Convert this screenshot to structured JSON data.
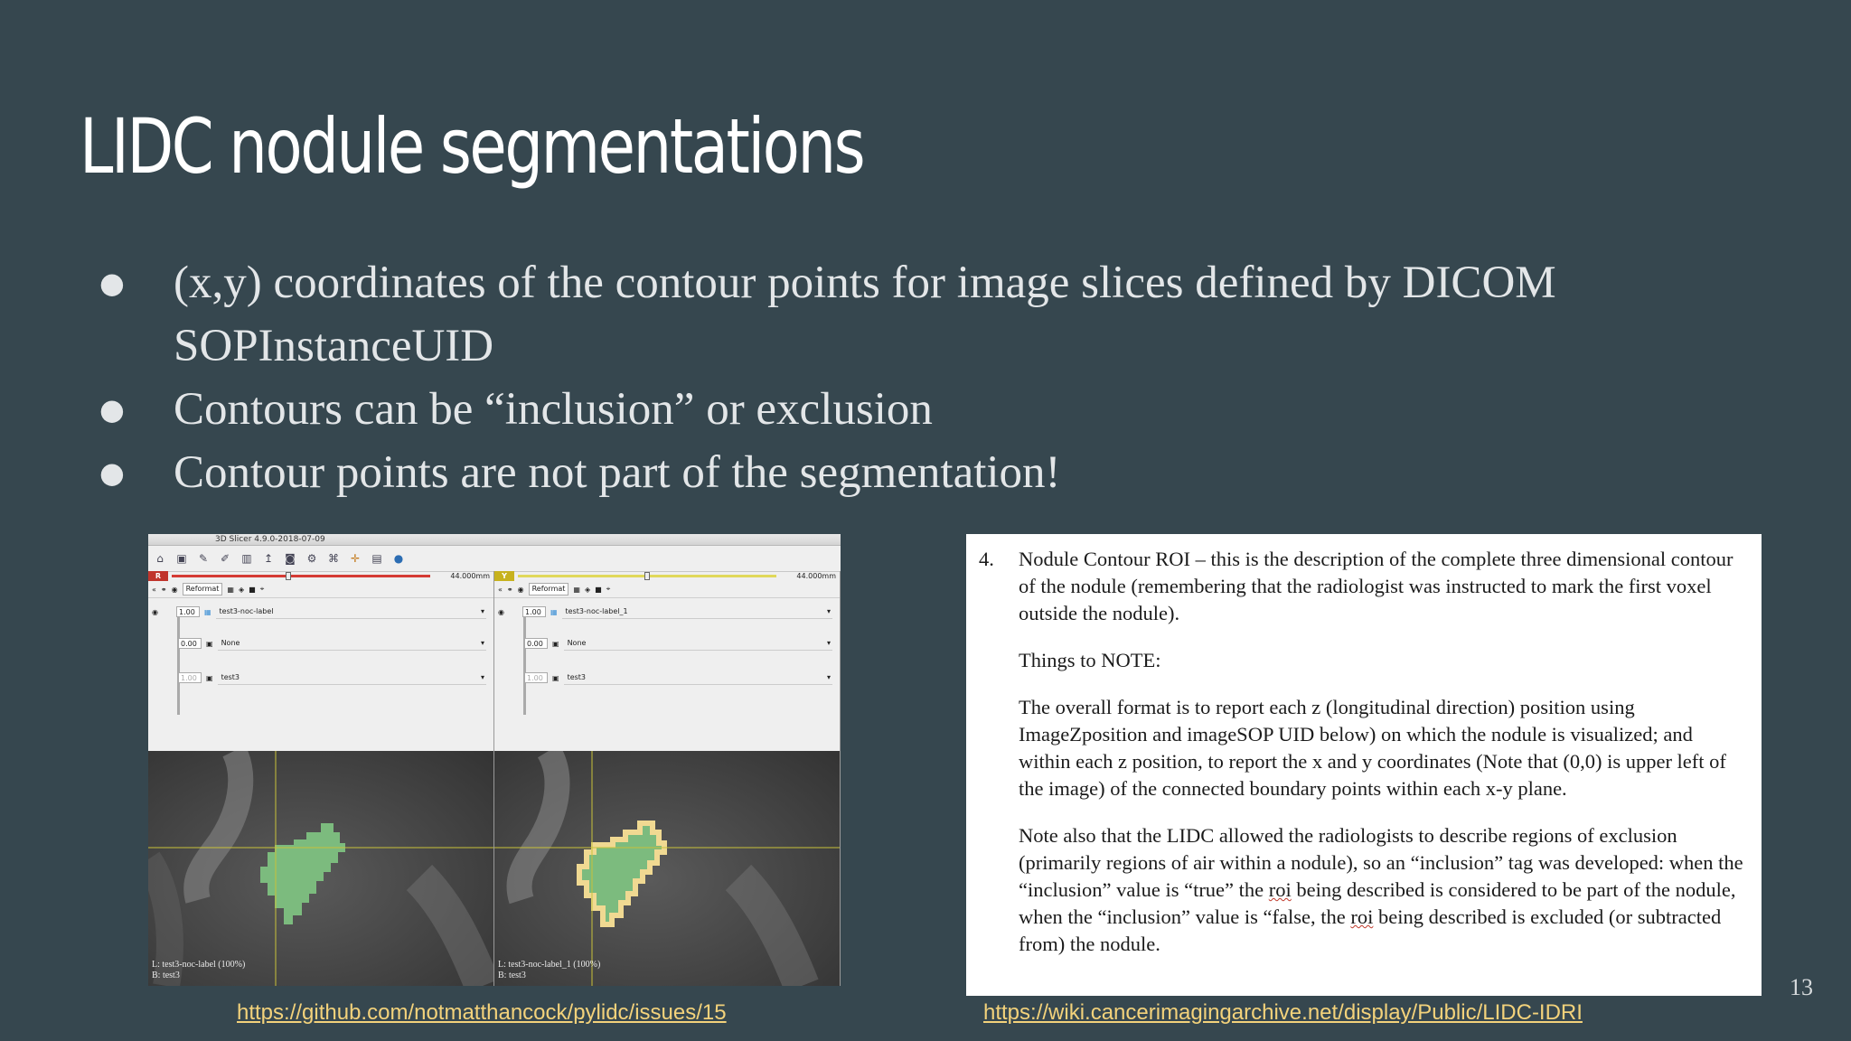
{
  "slide": {
    "title": "LIDC nodule segmentations",
    "bullets": [
      "(x,y) coordinates of the contour points for image slices defined by DICOM SOPInstanceUID",
      "Contours can be “inclusion” or exclusion",
      "Contour points are not part of the segmentation!"
    ],
    "page_number": "13",
    "links": {
      "left": "https://github.com/notmatthancock/pylidc/issues/15",
      "right": "https://wiki.cancerimagingarchive.net/display/Public/LIDC-IDRI"
    }
  },
  "slicer": {
    "window_title": "3D Slicer 4.9.0-2018-07-09",
    "views": [
      {
        "orientation": "R",
        "orientation_color": "#c0342c",
        "slider_color": "#d53b34",
        "offset": "44.000mm",
        "offset_fraction": 0.45,
        "reformat": "Reformat",
        "foreground_opacity": "1.00",
        "label_layer": "test3-noc-label",
        "middle_opacity": "0.00",
        "middle_layer": "None",
        "background_opacity": "1.00",
        "background_layer": "test3",
        "caption_label": "L: test3-noc-label (100%)",
        "caption_background": "B: test3"
      },
      {
        "orientation": "Y",
        "orientation_color": "#c7b21f",
        "slider_color": "#e0d85a",
        "offset": "44.000mm",
        "offset_fraction": 0.5,
        "reformat": "Reformat",
        "foreground_opacity": "1.00",
        "label_layer": "test3-noc-label_1",
        "middle_opacity": "0.00",
        "middle_layer": "None",
        "background_opacity": "1.00",
        "background_layer": "test3",
        "caption_label": "L: test3-noc-label_1 (100%)",
        "caption_background": "B: test3"
      }
    ],
    "colors": {
      "segmentation": "#7cbb7e",
      "contour": "#f0d992",
      "crosshair": "#c9c23a"
    }
  },
  "document": {
    "number": "4.",
    "heading": "Nodule Contour ROI – this is the description of the complete three dimensional contour of the nodule (remembering that the radiologist was instructed to mark the first voxel outside the nodule).",
    "things_label": "Things to NOTE:",
    "p1": "The overall format is to report each z (longitudinal direction) position using ImageZposition and imageSOP UID below) on which the nodule is visualized; and within each z position, to report the x and y coordinates (Note that (0,0) is upper left of the image) of the connected boundary points within each x-y plane.",
    "p2_a": "Note also that the LIDC allowed the radiologists to describe regions of exclusion (primarily regions of air within a nodule), so an “inclusion” tag was developed: when the “inclusion” value is “true” the ",
    "roi": "roi",
    "p2_b": " being described is considered to be part of the nodule, when the “inclusion” value is “false, the ",
    "p2_c": " being described is excluded (or subtracted from) the nodule."
  }
}
